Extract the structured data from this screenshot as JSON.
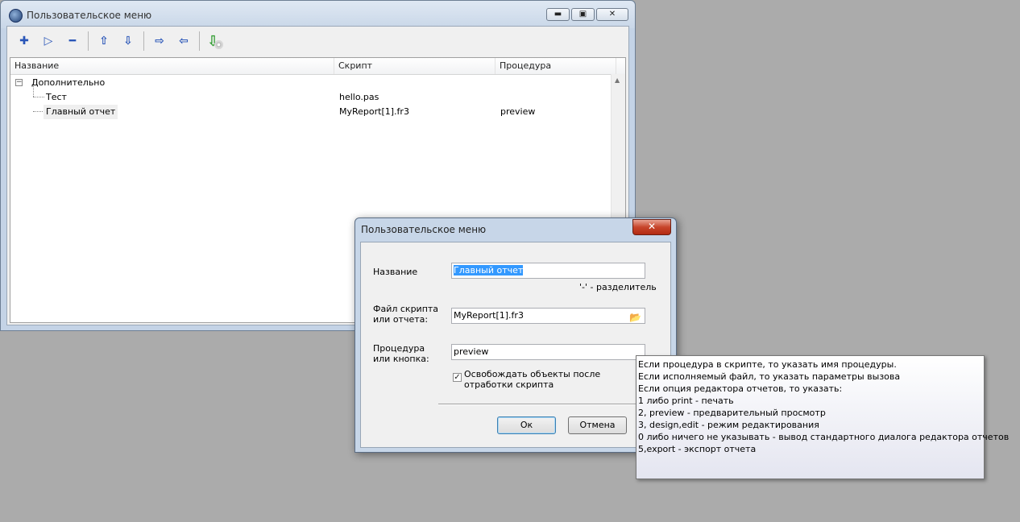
{
  "main_window": {
    "title": "Пользовательское меню",
    "buttons": {
      "minimize": "▬",
      "maximize": "▣",
      "close": "✕"
    },
    "toolbar_icons": [
      "plus-icon",
      "play-icon",
      "minus-icon",
      "arrow-up-icon",
      "arrow-down-icon",
      "arrow-right-icon",
      "arrow-left-icon",
      "import-disk-icon"
    ],
    "grid": {
      "columns": [
        "Название",
        "Скрипт",
        "Процедура"
      ],
      "rows": [
        {
          "name": "Дополнительно",
          "script": "",
          "procedure": "",
          "expander": "−"
        },
        {
          "name": "Тест",
          "script": "hello.pas",
          "procedure": ""
        },
        {
          "name": "Главный отчет",
          "script": "MyReport[1].fr3",
          "procedure": "preview"
        }
      ]
    }
  },
  "dialog": {
    "title": "Пользовательское меню",
    "close": "✕",
    "name_label": "Название",
    "name_value": "Главный отчет",
    "separator_hint": "'-' - разделитель",
    "file_label_1": "Файл скрипта",
    "file_label_2": "или отчета:",
    "file_value": "MyReport[1].fr3",
    "proc_label_1": "Процедура",
    "proc_label_2": "или кнопка:",
    "proc_value": "preview",
    "checkbox_checked": true,
    "checkbox_label_1": "Освобождать объекты после",
    "checkbox_label_2": "отработки скрипта",
    "ok": "Ок",
    "cancel": "Отмена"
  },
  "tooltip": {
    "lines": [
      "Если процедура в скрипте, то указать имя процедуры.",
      "Если исполняемый файл, то указать параметры вызова",
      "Если опция редактора отчетов, то указать:",
      "1 либо print - печать",
      "2, preview - предварительный просмотр",
      "3, design,edit - режим редактирования",
      "0 либо ничего не указывать - вывод стандартного диалога редактора отчетов",
      "5,export - экспорт отчета"
    ]
  }
}
